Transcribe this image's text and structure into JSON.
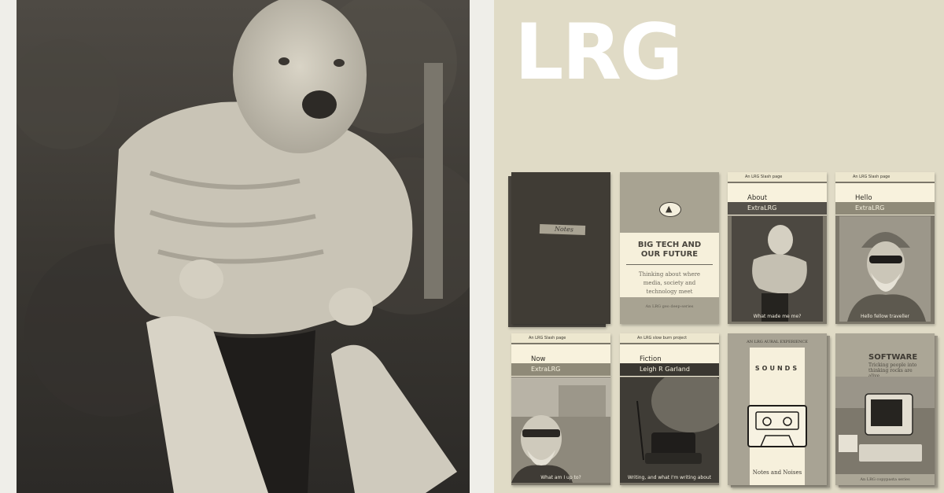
{
  "logo": {
    "text": "LRG"
  },
  "cards": {
    "notes": {
      "label": "Notes"
    },
    "bigtech": {
      "title": "BIG TECH AND OUR FUTURE",
      "subtitle": "Thinking about where media, society and technology meet",
      "footer": "An LRG geo deep-series"
    },
    "about": {
      "top": "An LRG Slash page",
      "title": "About",
      "sub": "ExtraLRG",
      "caption": "What made me me?"
    },
    "hello": {
      "top": "An LRG Slash page",
      "title": "Hello",
      "sub": "ExtraLRG",
      "caption": "Hello fellow traveller"
    },
    "now": {
      "top": "An LRG Slash page",
      "title": "Now",
      "sub": "ExtraLRG",
      "caption": "What am I up to?"
    },
    "fiction": {
      "top": "An LRG slow burn project",
      "title": "Fiction",
      "sub": "Leigh R Garland",
      "caption": "Writing, and what I'm writing about"
    },
    "sounds": {
      "top": "AN LRG AURAL EXPERIENCE",
      "title": "SOUNDS",
      "footer": "Notes and Noises"
    },
    "software": {
      "title": "SOFTWARE",
      "subtitle": "Tricking people into thinking rocks are alive",
      "footer": "An LRG copypasta series"
    }
  },
  "colors": {
    "background": "#e1dcc7",
    "logo": "#ffffff",
    "card_cream": "#f8f2dd",
    "card_grey": "#8f8a78"
  }
}
